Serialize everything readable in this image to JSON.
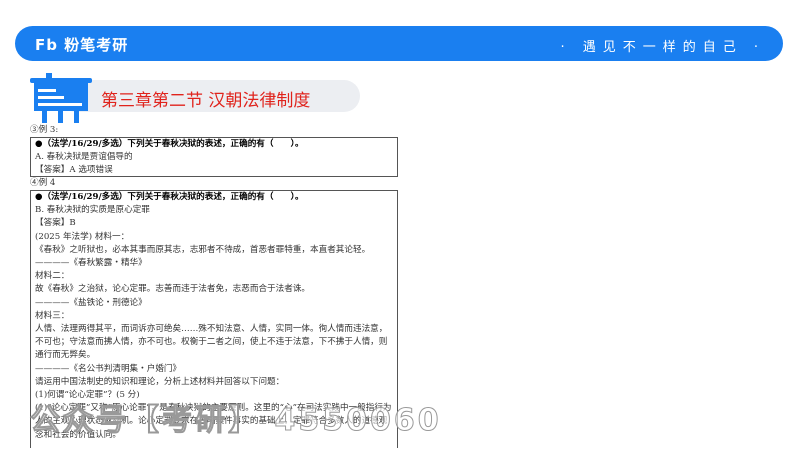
{
  "header": {
    "logo": "Fb 粉笔考研",
    "slogan": "· 遇见不一样的自己 ·"
  },
  "section_title": "第三章第二节 汉朝法律制度",
  "ex3": {
    "label": "③例 3:",
    "question": "●（法学/16/29/多选）下列关于春秋决狱的表述，正确的有（　　）。",
    "option": "A. 春秋决狱是贾谊倡导的",
    "answer": "【答案】A 选项错误"
  },
  "ex4": {
    "label": "④例 4",
    "question": "●（法学/16/29/多选）下列关于春秋决狱的表述，正确的有（　　）。",
    "option": "B. 春秋决狱的实质是原心定罪",
    "answer": "【答案】B",
    "lines": [
      "(2025 年法学) 材料一：",
      "《春秋》之听狱也，必本其事而原其志，志邪者不待成，首恶者罪特重，本直者其论轻。",
      "————《春秋繁露・精华》",
      "材料二：",
      "故《春秋》之治狱，论心定罪。志善而违于法者免，志恶而合于法者诛。",
      "————《盐铁论・刑德论》",
      "材料三：",
      "人情、法理两得其平，而词诉亦可绝矣……殊不知法意、人情，实同一体。徇人情而违法意，不可也；守法意而拂人情，亦不可也。权衡于二者之间，使上不违于法意，下不拂于人情，则通行而无弊矣。",
      "————《名公书判清明集・户婚门》",
      "请运用中国法制史的知识和理论，分析上述材料并回答以下问题：",
      "(1)何谓“论心定罪”？(5 分)",
      "(1)“论心定罪”又称“原心论罪”，是春秋决狱的主要原则。这里的“心”在司法实践中一般指行为人的主观心理状态或动机。论心定罪要求在查明案件事实的基础上，定罪符合多数人的道德观念和社会的价值认同。"
    ]
  },
  "watermark": "公众号【考研】 4550060"
}
